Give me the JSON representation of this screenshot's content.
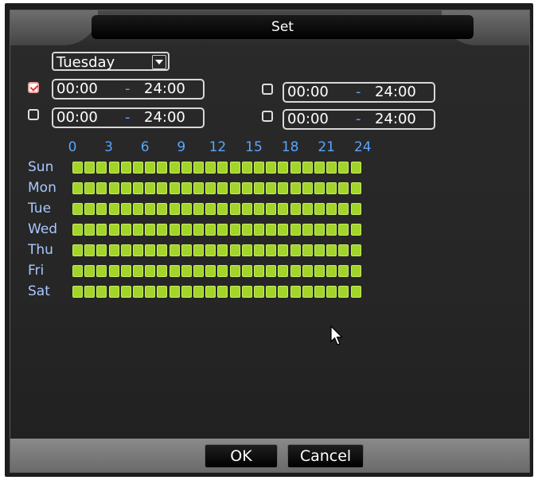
{
  "window": {
    "title": "Set"
  },
  "schedule": {
    "day_select": "Tuesday",
    "periods": [
      {
        "checked": true,
        "start": "00:00",
        "sep": "-",
        "end": "24:00"
      },
      {
        "checked": false,
        "start": "00:00",
        "sep": "-",
        "end": "24:00"
      },
      {
        "checked": false,
        "start": "00:00",
        "sep": "-",
        "end": "24:00"
      },
      {
        "checked": false,
        "start": "00:00",
        "sep": "-",
        "end": "24:00"
      }
    ],
    "hour_labels": [
      "0",
      "3",
      "6",
      "9",
      "12",
      "15",
      "18",
      "21",
      "24"
    ],
    "days": [
      "Sun",
      "Mon",
      "Tue",
      "Wed",
      "Thu",
      "Fri",
      "Sat"
    ],
    "slots_per_day": 24,
    "active_color": "#a3d42a"
  },
  "buttons": {
    "ok": "OK",
    "cancel": "Cancel"
  }
}
